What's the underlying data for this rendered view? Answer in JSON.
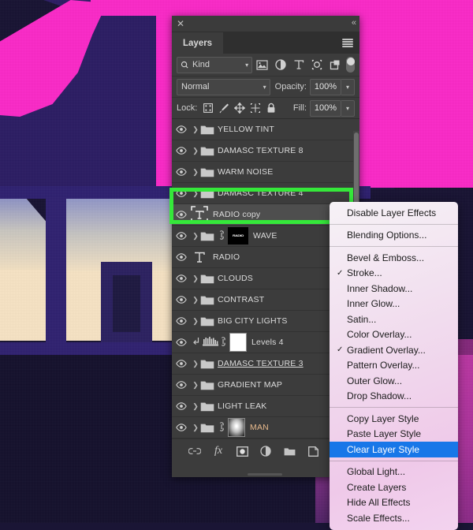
{
  "panel": {
    "title": "Layers",
    "close_icon": "close-icon",
    "collapse_icon": "collapse-double-arrow-icon",
    "menu_icon": "panel-menu-icon",
    "filter": {
      "kind_label": "Kind",
      "search_icon": "search-icon",
      "chevron": "⌄",
      "icons": [
        {
          "name": "filter-pixel-icon",
          "glyph": "image"
        },
        {
          "name": "filter-adjustment-icon",
          "glyph": "half-circle"
        },
        {
          "name": "filter-type-icon",
          "glyph": "T"
        },
        {
          "name": "filter-shape-icon",
          "glyph": "shape"
        },
        {
          "name": "filter-smart-object-icon",
          "glyph": "smart"
        }
      ],
      "toggle_name": "filter-enable-toggle"
    },
    "blend": {
      "mode": "Normal",
      "opacity_label": "Opacity:",
      "opacity_value": "100%",
      "fill_label": "Fill:",
      "fill_value": "100%"
    },
    "lock": {
      "label": "Lock:",
      "icons": [
        {
          "name": "lock-transparent-pixels-icon"
        },
        {
          "name": "lock-image-pixels-icon"
        },
        {
          "name": "lock-position-icon"
        },
        {
          "name": "lock-artboard-nesting-icon"
        },
        {
          "name": "lock-all-icon"
        }
      ]
    },
    "layers": [
      {
        "name": "YELLOW TINT",
        "type": "group",
        "visible": true,
        "fx": false
      },
      {
        "name": "DAMASC TEXTURE 8",
        "type": "group",
        "visible": true,
        "fx": false
      },
      {
        "name": "WARM NOISE",
        "type": "group",
        "visible": true,
        "fx": false
      },
      {
        "name": "DAMASC TEXTURE 4",
        "type": "group",
        "visible": true,
        "fx": false
      },
      {
        "name": "RADIO copy",
        "type": "text",
        "visible": true,
        "fx": true,
        "selected": true
      },
      {
        "name": "WAVE",
        "type": "group-masked",
        "visible": true,
        "fx": true
      },
      {
        "name": "RADIO",
        "type": "text",
        "visible": true,
        "fx": true
      },
      {
        "name": "CLOUDS",
        "type": "group",
        "visible": true,
        "fx": false
      },
      {
        "name": "CONTRAST",
        "type": "group",
        "visible": true,
        "fx": false
      },
      {
        "name": "BIG CITY LIGHTS",
        "type": "group",
        "visible": true,
        "fx": false
      },
      {
        "name": "Levels 4",
        "type": "adjustment",
        "visible": true,
        "fx": false,
        "clipped": true
      },
      {
        "name": "DAMASC TEXTURE 3",
        "type": "group",
        "visible": true,
        "fx": false,
        "underline": true
      },
      {
        "name": "GRADIENT MAP",
        "type": "group",
        "visible": true,
        "fx": false
      },
      {
        "name": "LIGHT LEAK",
        "type": "group",
        "visible": true,
        "fx": false
      },
      {
        "name": "MAN",
        "type": "group-masked-gradient",
        "visible": true,
        "fx": false,
        "tan": true
      }
    ],
    "wave_thumb_text": "RADIO",
    "footer_icons": [
      {
        "name": "link-layers-icon"
      },
      {
        "name": "add-layer-style-fx-icon"
      },
      {
        "name": "add-layer-mask-icon"
      },
      {
        "name": "new-fill-adjustment-layer-icon"
      },
      {
        "name": "new-group-icon"
      },
      {
        "name": "new-layer-icon"
      },
      {
        "name": "delete-layer-icon"
      }
    ]
  },
  "context_menu": {
    "groups": [
      [
        {
          "label": "Disable Layer Effects",
          "checked": false,
          "selected": false
        }
      ],
      [
        {
          "label": "Blending Options...",
          "checked": false,
          "selected": false
        }
      ],
      [
        {
          "label": "Bevel & Emboss...",
          "checked": false,
          "selected": false
        },
        {
          "label": "Stroke...",
          "checked": true,
          "selected": false
        },
        {
          "label": "Inner Shadow...",
          "checked": false,
          "selected": false
        },
        {
          "label": "Inner Glow...",
          "checked": false,
          "selected": false
        },
        {
          "label": "Satin...",
          "checked": false,
          "selected": false
        },
        {
          "label": "Color Overlay...",
          "checked": false,
          "selected": false
        },
        {
          "label": "Gradient Overlay...",
          "checked": true,
          "selected": false
        },
        {
          "label": "Pattern Overlay...",
          "checked": false,
          "selected": false
        },
        {
          "label": "Outer Glow...",
          "checked": false,
          "selected": false
        },
        {
          "label": "Drop Shadow...",
          "checked": false,
          "selected": false
        }
      ],
      [
        {
          "label": "Copy Layer Style",
          "checked": false,
          "selected": false
        },
        {
          "label": "Paste Layer Style",
          "checked": false,
          "selected": false
        },
        {
          "label": "Clear Layer Style",
          "checked": false,
          "selected": true
        }
      ],
      [
        {
          "label": "Global Light...",
          "checked": false,
          "selected": false
        },
        {
          "label": "Create Layers",
          "checked": false,
          "selected": false
        },
        {
          "label": "Hide All Effects",
          "checked": false,
          "selected": false
        },
        {
          "label": "Scale Effects...",
          "checked": false,
          "selected": false
        }
      ]
    ],
    "check_glyph": "✓"
  },
  "annotation": {
    "highlight_color": "#35E83A",
    "highlight_target": "RADIO copy"
  },
  "artwork": {
    "colors": {
      "magenta": "#FB29C8",
      "purple_dark": "#1C1340",
      "purple": "#2B1C63",
      "cream": "#F7E3C4",
      "deep_navy": "#14102C"
    }
  }
}
